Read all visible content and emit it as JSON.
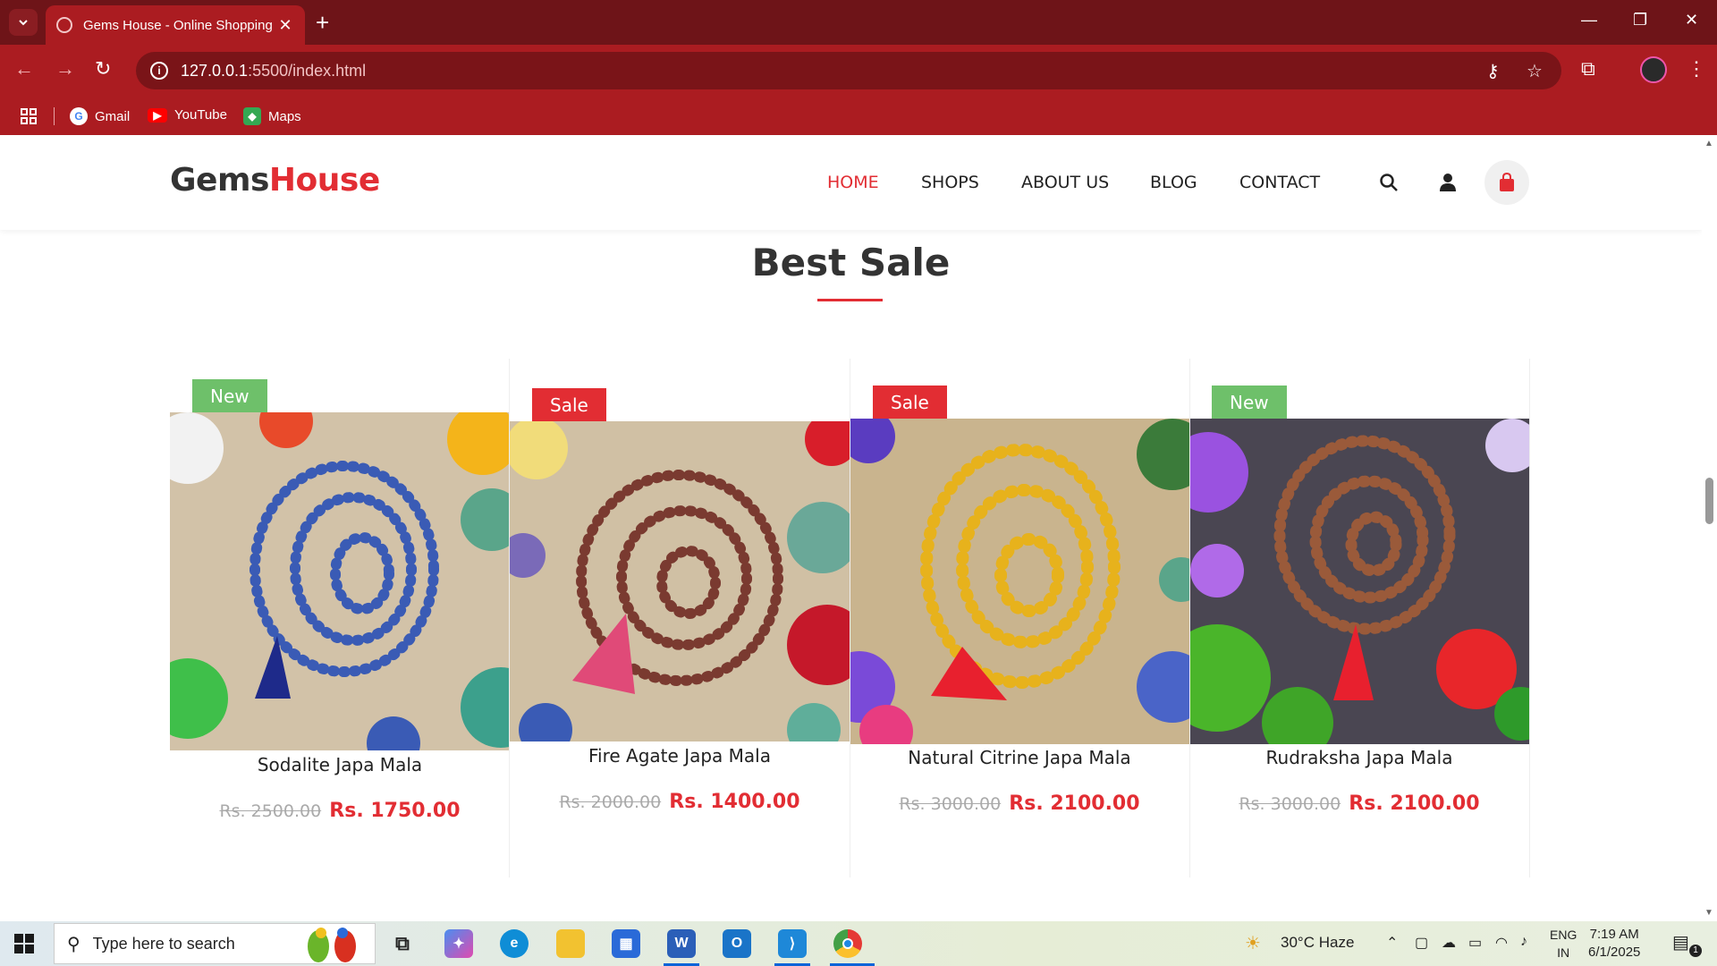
{
  "browser": {
    "tab_title": "Gems House - Online Shopping",
    "url_host": "127.0.0.1",
    "url_path": ":5500/index.html",
    "bookmarks": [
      {
        "label": "Gmail",
        "icon": "google-icon"
      },
      {
        "label": "YouTube",
        "icon": "youtube-icon"
      },
      {
        "label": "Maps",
        "icon": "maps-icon"
      }
    ]
  },
  "site": {
    "logo_part1": "Gems",
    "logo_part2": "House",
    "nav": [
      "HOME",
      "SHOPS",
      "ABOUT US",
      "BLOG",
      "CONTACT"
    ],
    "active_nav": "HOME",
    "accent_color": "#e22d33"
  },
  "section": {
    "title": "Best Sale"
  },
  "products": [
    {
      "badge": "New",
      "name": "Sodalite Japa Mala",
      "old_price": "Rs. 2500.00",
      "price": "Rs. 1750.00",
      "bead_color": "#3a5bb5",
      "tassel_color": "#1e2a8a"
    },
    {
      "badge": "Sale",
      "name": "Fire Agate Japa Mala",
      "old_price": "Rs. 2000.00",
      "price": "Rs. 1400.00",
      "bead_color": "#7a3a30",
      "tassel_color": "#e04a78"
    },
    {
      "badge": "Sale",
      "name": "Natural Citrine Japa Mala",
      "old_price": "Rs. 3000.00",
      "price": "Rs. 2100.00",
      "bead_color": "#e7b21c",
      "tassel_color": "#e8202e"
    },
    {
      "badge": "New",
      "name": "Rudraksha Japa Mala",
      "old_price": "Rs. 3000.00",
      "price": "Rs. 2100.00",
      "bead_color": "#9a5a3a",
      "tassel_color": "#e8202e"
    }
  ],
  "taskbar": {
    "search_placeholder": "Type here to search",
    "weather": "30°C  Haze",
    "lang_line1": "ENG",
    "lang_line2": "IN",
    "time": "7:19 AM",
    "date": "6/1/2025",
    "notification_count": "1"
  }
}
